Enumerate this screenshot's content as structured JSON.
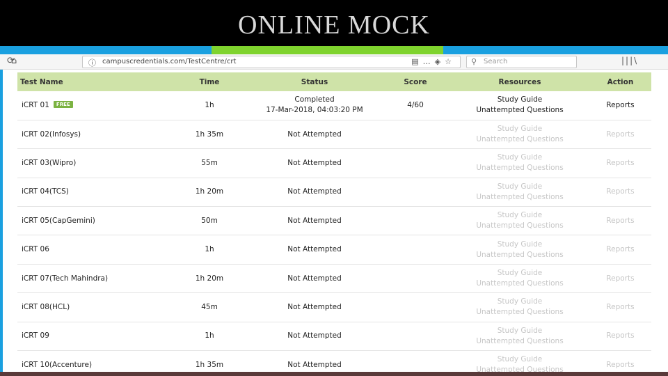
{
  "slide": {
    "title": "ONLINE MOCK"
  },
  "browser": {
    "url": "campuscredentials.com/TestCentre/crt",
    "search_placeholder": "Search"
  },
  "icons": {
    "back": "back-arrow-icon",
    "forward": "forward-arrow-icon",
    "refresh": "refresh-icon",
    "home": "home-icon",
    "info": "info-icon",
    "reader": "reader-view-icon",
    "pocket": "pocket-icon",
    "bookmark": "bookmark-star-icon",
    "search": "search-icon",
    "library": "library-icon"
  },
  "colors": {
    "header_bg": "#cfe3a8",
    "accent_blue": "#1aa0e0",
    "accent_green": "#7fd32e",
    "badge_green": "#7cb342",
    "muted_text": "#c6c6c6"
  },
  "table": {
    "headers": {
      "name": "Test Name",
      "time": "Time",
      "status": "Status",
      "score": "Score",
      "resources": "Resources",
      "action": "Action"
    },
    "rows": [
      {
        "name": "iCRT 01",
        "badge": "FREE",
        "time": "1h",
        "status": "Completed",
        "status_date": "17-Mar-2018, 04:03:20 PM",
        "score": "4/60",
        "resource_1": "Study Guide",
        "resource_2": "Unattempted Questions",
        "action": "Reports"
      },
      {
        "name": "iCRT 02(Infosys)",
        "badge": "",
        "time": "1h 35m",
        "status": "Not Attempted",
        "status_date": "",
        "score": "",
        "resource_1": "Study Guide",
        "resource_2": "Unattempted Questions",
        "action": "Reports"
      },
      {
        "name": "iCRT 03(Wipro)",
        "badge": "",
        "time": "55m",
        "status": "Not Attempted",
        "status_date": "",
        "score": "",
        "resource_1": "Study Guide",
        "resource_2": "Unattempted Questions",
        "action": "Reports"
      },
      {
        "name": "iCRT 04(TCS)",
        "badge": "",
        "time": "1h 20m",
        "status": "Not Attempted",
        "status_date": "",
        "score": "",
        "resource_1": "Study Guide",
        "resource_2": "Unattempted Questions",
        "action": "Reports"
      },
      {
        "name": "iCRT 05(CapGemini)",
        "badge": "",
        "time": "50m",
        "status": "Not Attempted",
        "status_date": "",
        "score": "",
        "resource_1": "Study Guide",
        "resource_2": "Unattempted Questions",
        "action": "Reports"
      },
      {
        "name": "iCRT 06",
        "badge": "",
        "time": "1h",
        "status": "Not Attempted",
        "status_date": "",
        "score": "",
        "resource_1": "Study Guide",
        "resource_2": "Unattempted Questions",
        "action": "Reports"
      },
      {
        "name": "iCRT 07(Tech Mahindra)",
        "badge": "",
        "time": "1h 20m",
        "status": "Not Attempted",
        "status_date": "",
        "score": "",
        "resource_1": "Study Guide",
        "resource_2": "Unattempted Questions",
        "action": "Reports"
      },
      {
        "name": "iCRT 08(HCL)",
        "badge": "",
        "time": "45m",
        "status": "Not Attempted",
        "status_date": "",
        "score": "",
        "resource_1": "Study Guide",
        "resource_2": "Unattempted Questions",
        "action": "Reports"
      },
      {
        "name": "iCRT 09",
        "badge": "",
        "time": "1h",
        "status": "Not Attempted",
        "status_date": "",
        "score": "",
        "resource_1": "Study Guide",
        "resource_2": "Unattempted Questions",
        "action": "Reports"
      },
      {
        "name": "iCRT 10(Accenture)",
        "badge": "",
        "time": "1h 35m",
        "status": "Not Attempted",
        "status_date": "",
        "score": "",
        "resource_1": "Study Guide",
        "resource_2": "Unattempted Questions",
        "action": "Reports"
      }
    ]
  }
}
